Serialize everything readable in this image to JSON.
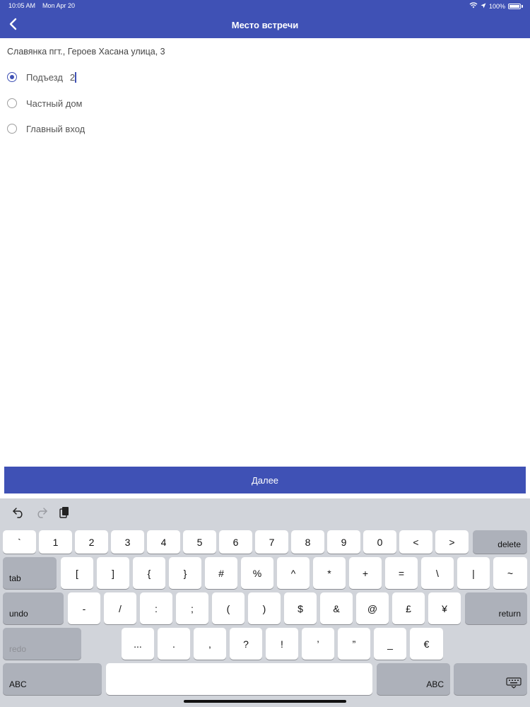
{
  "status_bar": {
    "time": "10:05 AM",
    "date": "Mon Apr 20",
    "battery": "100%"
  },
  "header": {
    "title": "Место встречи"
  },
  "address": "Славянка пгт., Героев Хасана улица, 3",
  "options": [
    {
      "label": "Подъезд",
      "selected": true
    },
    {
      "label": "Частный дом",
      "selected": false
    },
    {
      "label": "Главный вход",
      "selected": false
    }
  ],
  "entrance_input": {
    "value": "2"
  },
  "next_button": {
    "label": "Далее"
  },
  "keyboard": {
    "row1": [
      "`",
      "1",
      "2",
      "3",
      "4",
      "5",
      "6",
      "7",
      "8",
      "9",
      "0",
      "<",
      ">"
    ],
    "delete": "delete",
    "tab": "tab",
    "row2": [
      "[",
      "]",
      "{",
      "}",
      "#",
      "%",
      "^",
      "*",
      "+",
      "=",
      "\\",
      "|",
      "~"
    ],
    "undo": "undo",
    "row3": [
      "-",
      "/",
      ":",
      ";",
      "(",
      ")",
      "$",
      "&",
      "@",
      "£",
      "¥"
    ],
    "return": "return",
    "redo": "redo",
    "row4": [
      "...",
      ".",
      ",",
      "?",
      "!",
      "’",
      "”",
      "_",
      "€"
    ],
    "abc_left": "ABC",
    "abc_right": "ABC"
  },
  "colors": {
    "primary": "#3f51b5",
    "keyboard_bg": "#d1d4da",
    "dark_key": "#adb1ba"
  }
}
